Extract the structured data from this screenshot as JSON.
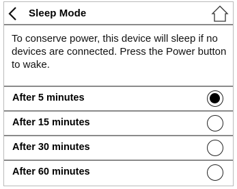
{
  "header": {
    "title": "Sleep Mode",
    "back_icon": "chevron-left-icon",
    "home_icon": "home-icon"
  },
  "description": "To conserve power, this device will sleep if no devices are connected. Press the Power button to wake.",
  "options": [
    {
      "label": "After 5 minutes",
      "selected": true
    },
    {
      "label": "After 15 minutes",
      "selected": false
    },
    {
      "label": "After 30 minutes",
      "selected": false
    },
    {
      "label": "After 60 minutes",
      "selected": false
    }
  ]
}
